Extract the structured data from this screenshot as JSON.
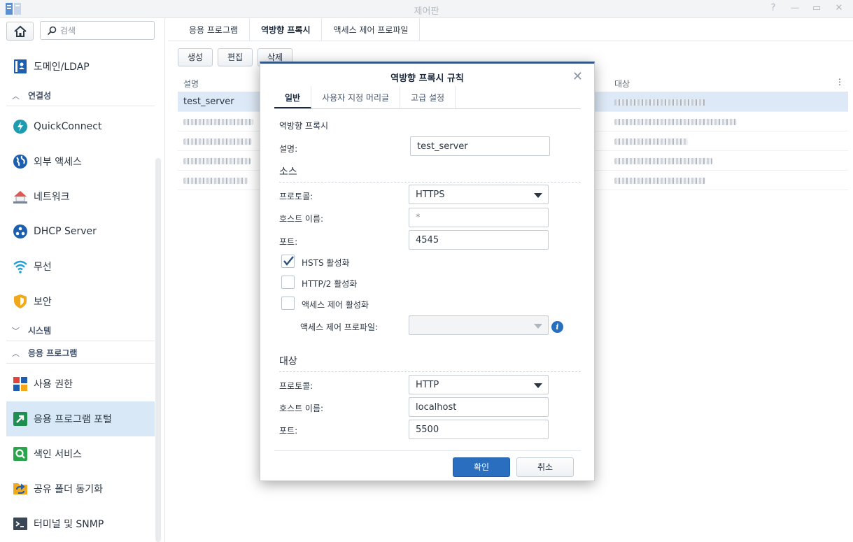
{
  "window": {
    "title": "제어판",
    "help": "?",
    "minimize": "—",
    "maximize": "▭",
    "close": "✕"
  },
  "sidebar": {
    "search_placeholder": "검색",
    "items": [
      {
        "label": "도메인/LDAP",
        "icon": "domain-ldap-icon"
      },
      {
        "label": "연결성",
        "icon": "chevron-up-icon",
        "group": true
      },
      {
        "label": "QuickConnect",
        "icon": "quickconnect-icon"
      },
      {
        "label": "외부 액세스",
        "icon": "globe-icon"
      },
      {
        "label": "네트워크",
        "icon": "network-house-icon"
      },
      {
        "label": "DHCP Server",
        "icon": "dhcp-server-icon"
      },
      {
        "label": "무선",
        "icon": "wifi-icon"
      },
      {
        "label": "보안",
        "icon": "shield-icon"
      },
      {
        "label": "시스템",
        "icon": "chevron-down-icon",
        "group": true
      },
      {
        "label": "응용 프로그램",
        "icon": "chevron-up-icon",
        "group": true
      },
      {
        "label": "사용 권한",
        "icon": "privileges-icon"
      },
      {
        "label": "응용 프로그램 포털",
        "icon": "application-portal-icon",
        "active": true
      },
      {
        "label": "색인 서비스",
        "icon": "indexing-service-icon"
      },
      {
        "label": "공유 폴더 동기화",
        "icon": "shared-folder-sync-icon"
      },
      {
        "label": "터미널 및 SNMP",
        "icon": "terminal-icon"
      }
    ]
  },
  "main": {
    "tabs": [
      {
        "label": "응용 프로그램"
      },
      {
        "label": "역방향 프록시",
        "active": true
      },
      {
        "label": "액세스 제어 프로파일"
      }
    ],
    "toolbar": {
      "create": "생성",
      "edit": "편집",
      "delete": "삭제"
    },
    "grid": {
      "columns": [
        "설명",
        "대상"
      ],
      "rows": [
        {
          "description": "test_server"
        }
      ]
    }
  },
  "dialog": {
    "title": "역방향 프록시 규칙",
    "tabs": [
      "일반",
      "사용자 지정 머리글",
      "고급 설정"
    ],
    "section_label": "역방향 프록시",
    "description_label": "설명:",
    "description_value": "test_server",
    "source": {
      "heading": "소스",
      "protocol_label": "프로토콜:",
      "protocol_value": "HTTPS",
      "hostname_label": "호스트 이름:",
      "hostname_value": "*",
      "port_label": "포트:",
      "port_value": "4545"
    },
    "hsts": {
      "label": "HSTS 활성화",
      "checked": true
    },
    "http2": {
      "label": "HTTP/2 활성화",
      "checked": false
    },
    "access_control": {
      "label": "액세스 제어 활성화",
      "checked": false
    },
    "access_profile_label": "액세스 제어 프로파일:",
    "info_glyph": "i",
    "destination": {
      "heading": "대상",
      "protocol_label": "프로토콜:",
      "protocol_value": "HTTP",
      "hostname_label": "호스트 이름:",
      "hostname_value": "localhost",
      "port_label": "포트:",
      "port_value": "5500"
    },
    "ok": "확인",
    "cancel": "취소"
  },
  "colors": {
    "accent": "#2a6fbf",
    "selection": "#dde9f6",
    "dialog_border": "#33578a"
  }
}
